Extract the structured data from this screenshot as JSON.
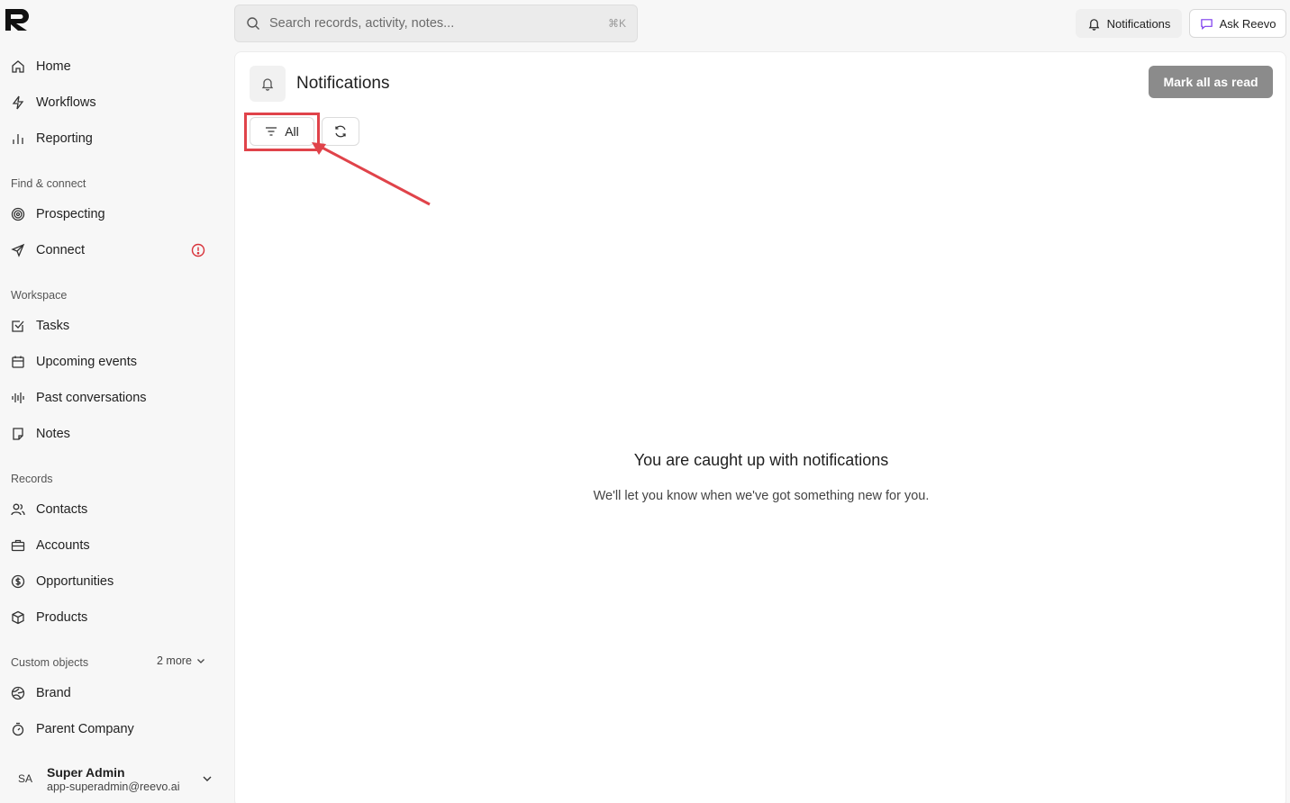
{
  "sidebar": {
    "primary": [
      {
        "label": "Home",
        "icon": "home-icon"
      },
      {
        "label": "Workflows",
        "icon": "lightning-icon"
      },
      {
        "label": "Reporting",
        "icon": "bar-chart-icon"
      }
    ],
    "find_connect": {
      "label": "Find & connect",
      "items": [
        {
          "label": "Prospecting",
          "icon": "target-icon"
        },
        {
          "label": "Connect",
          "icon": "send-icon",
          "alert_icon": "alert-circle-icon"
        }
      ]
    },
    "workspace": {
      "label": "Workspace",
      "items": [
        {
          "label": "Tasks",
          "icon": "checkbox-icon"
        },
        {
          "label": "Upcoming events",
          "icon": "calendar-icon"
        },
        {
          "label": "Past conversations",
          "icon": "waveform-icon"
        },
        {
          "label": "Notes",
          "icon": "note-icon"
        }
      ]
    },
    "records": {
      "label": "Records",
      "items": [
        {
          "label": "Contacts",
          "icon": "users-icon"
        },
        {
          "label": "Accounts",
          "icon": "briefcase-icon"
        },
        {
          "label": "Opportunities",
          "icon": "dollar-circle-icon"
        },
        {
          "label": "Products",
          "icon": "box-icon"
        }
      ]
    },
    "custom_objects": {
      "label": "Custom objects",
      "more": "2 more",
      "items": [
        {
          "label": "Brand",
          "icon": "globe-icon"
        },
        {
          "label": "Parent Company",
          "icon": "stopwatch-icon"
        }
      ]
    },
    "user": {
      "initials": "SA",
      "name": "Super Admin",
      "email": "app-superadmin@reevo.ai"
    }
  },
  "topbar": {
    "search_placeholder": "Search records, activity, notes...",
    "search_shortcut": "⌘K",
    "notifications_label": "Notifications",
    "ask_label": "Ask Reevo"
  },
  "main": {
    "title": "Notifications",
    "mark_all_label": "Mark all as read",
    "filter_label": "All",
    "empty_title": "You are caught up with notifications",
    "empty_subtitle": "We'll let you know when we've got something new for you."
  },
  "colors": {
    "annotation": "#e0434a",
    "accent_purple": "#7c3aed"
  }
}
